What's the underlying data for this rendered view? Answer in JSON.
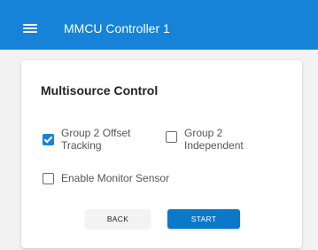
{
  "app": {
    "title": "MMCU Controller 1",
    "menu_icon": "hamburger-menu-icon",
    "accent_color": "#1683d8"
  },
  "card": {
    "title": "Multisource Control",
    "options": [
      {
        "label": "Group 2 Offset\nTracking",
        "checked": true
      },
      {
        "label": "Group 2\nIndependent",
        "checked": false
      },
      {
        "label": "Enable Monitor Sensor",
        "checked": false
      }
    ],
    "buttons": {
      "back_label": "BACK",
      "start_label": "START"
    }
  }
}
